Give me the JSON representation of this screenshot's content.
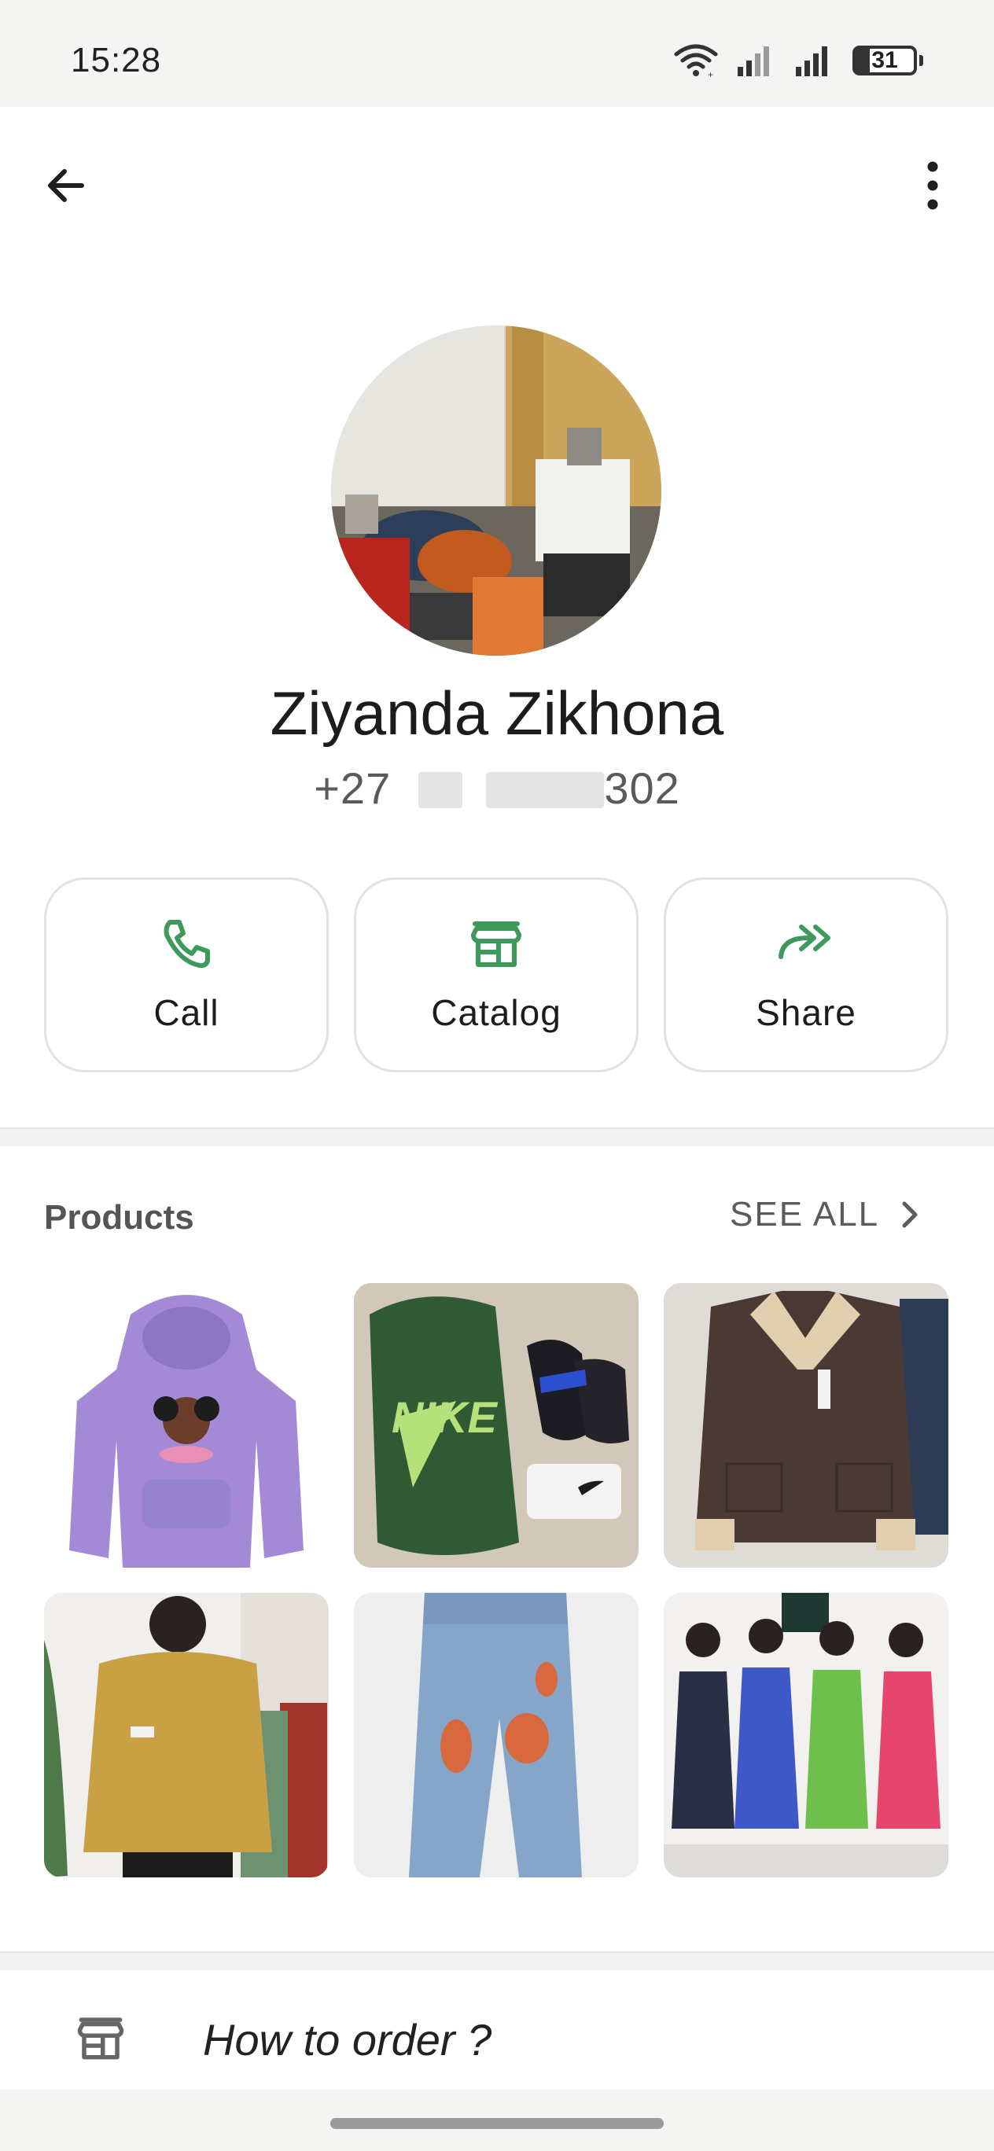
{
  "status_bar": {
    "time": "15:28",
    "battery": "31"
  },
  "profile": {
    "name": "Ziyanda Zikhona",
    "phone_prefix": "+27",
    "phone_suffix": "302"
  },
  "actions": [
    {
      "label": "Call",
      "icon": "phone-icon"
    },
    {
      "label": "Catalog",
      "icon": "storefront-icon"
    },
    {
      "label": "Share",
      "icon": "forward-icon"
    }
  ],
  "products_section": {
    "title": "Products",
    "see_all": "SEE ALL"
  },
  "products": [
    {
      "icon": "purple-hoodie-image"
    },
    {
      "icon": "green-backpack-slides-image"
    },
    {
      "icon": "brown-shearling-jacket-image"
    },
    {
      "icon": "yellow-fleece-jacket-image"
    },
    {
      "icon": "ripped-jeans-image"
    },
    {
      "icon": "floral-dresses-image"
    }
  ],
  "bottom": {
    "label": "How to order ?"
  },
  "colors": {
    "accent": "#3d9a5c",
    "divider": "#f0f1f0"
  }
}
